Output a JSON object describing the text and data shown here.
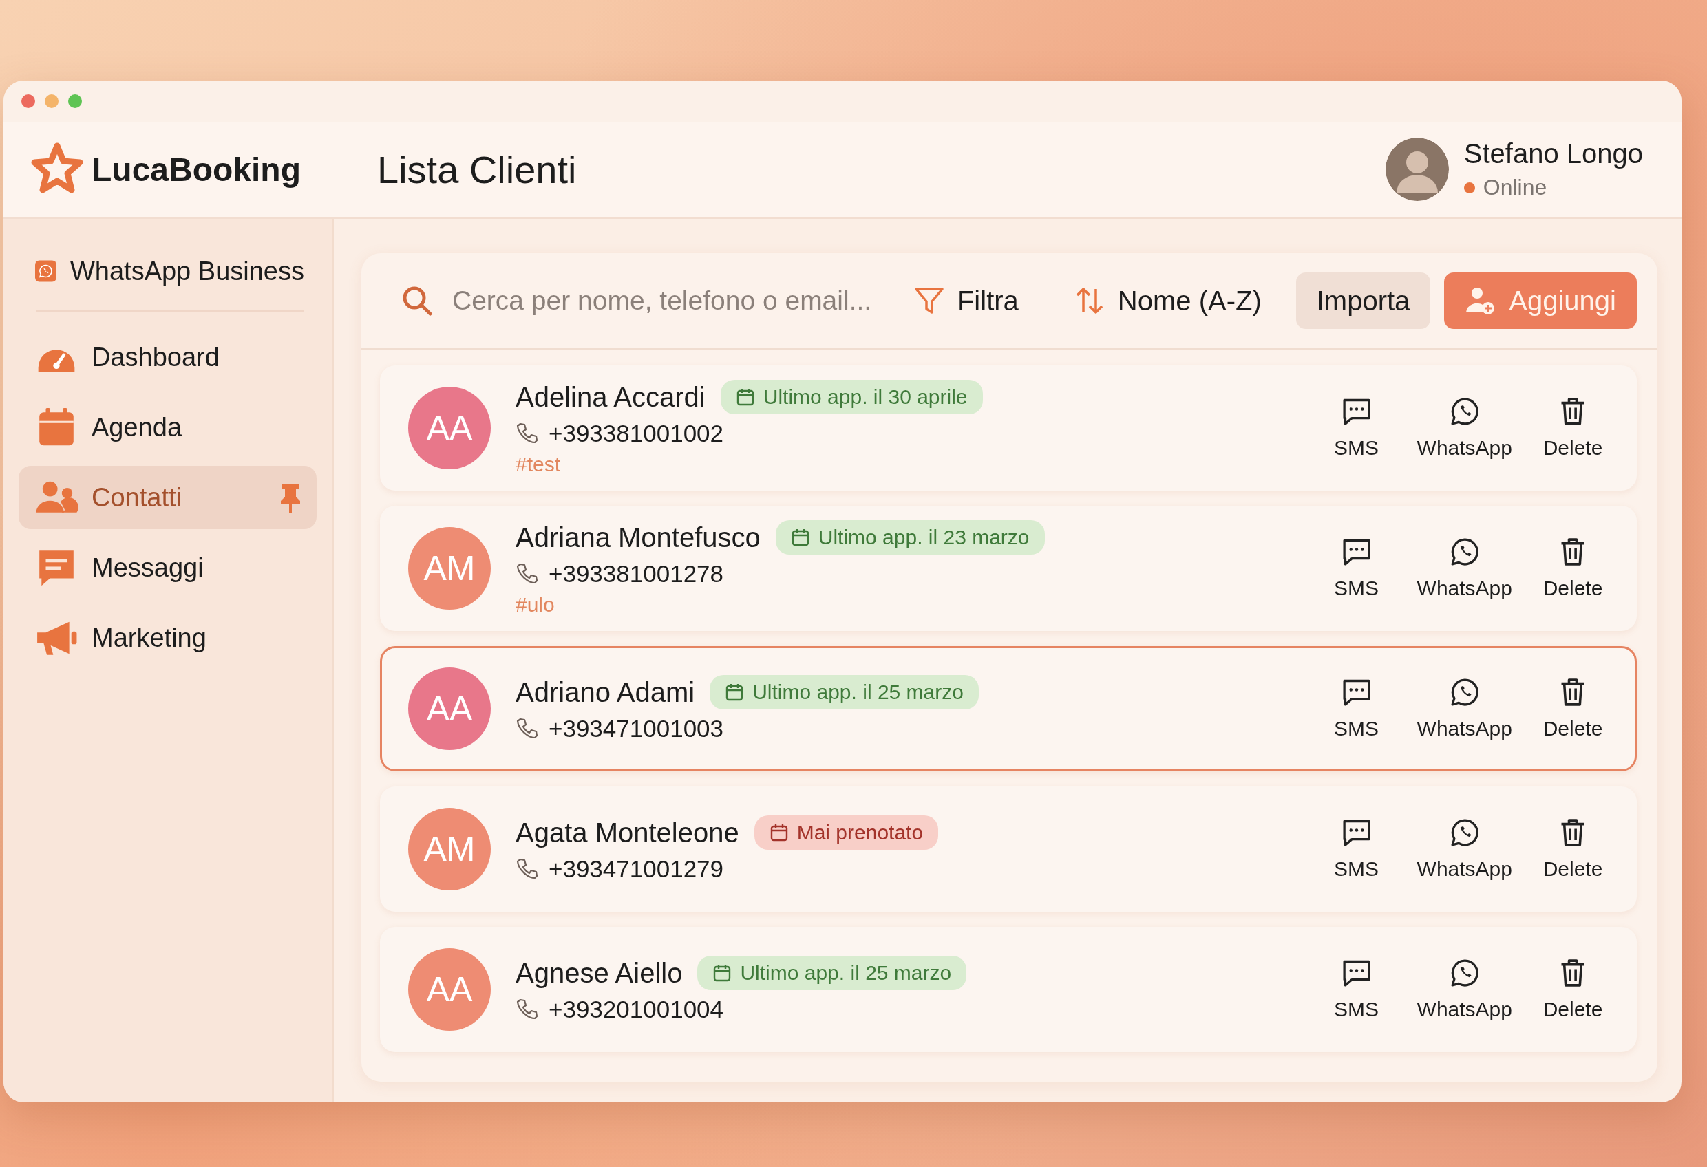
{
  "header": {
    "brand": "LucaBooking",
    "page_title": "Lista Clienti",
    "user": {
      "name": "Stefano Longo",
      "status": "Online"
    }
  },
  "sidebar": {
    "items": [
      {
        "label": "WhatsApp Business",
        "selected": false,
        "pinned": false
      },
      {
        "label": "Dashboard",
        "selected": false,
        "pinned": false
      },
      {
        "label": "Agenda",
        "selected": false,
        "pinned": false
      },
      {
        "label": "Contatti",
        "selected": true,
        "pinned": true
      },
      {
        "label": "Messaggi",
        "selected": false,
        "pinned": false
      },
      {
        "label": "Marketing",
        "selected": false,
        "pinned": false
      }
    ]
  },
  "toolbar": {
    "search": {
      "placeholder": "Cerca per nome, telefono o email..."
    },
    "filter": "Filtra",
    "sort": "Nome (A-Z)",
    "import": "Importa",
    "add": "Aggiungi"
  },
  "clients": [
    {
      "initials": "AA",
      "color": "#e8778a",
      "name": "Adelina Accardi",
      "badge": {
        "kind": "last",
        "text": "Ultimo app. il 30 aprile"
      },
      "phone": "+393381001002",
      "tag": "#test",
      "selected": false,
      "actions": [
        "SMS",
        "WhatsApp",
        "Delete"
      ]
    },
    {
      "initials": "AM",
      "color": "#ee8c73",
      "name": "Adriana Montefusco",
      "badge": {
        "kind": "last",
        "text": "Ultimo app. il 23 marzo"
      },
      "phone": "+393381001278",
      "tag": "#ulo",
      "selected": false,
      "actions": [
        "SMS",
        "WhatsApp",
        "Delete"
      ]
    },
    {
      "initials": "AA",
      "color": "#e8778a",
      "name": "Adriano Adami",
      "badge": {
        "kind": "last",
        "text": "Ultimo app. il 25 marzo"
      },
      "phone": "+393471001003",
      "selected": true,
      "actions": [
        "SMS",
        "WhatsApp",
        "Delete"
      ]
    },
    {
      "initials": "AM",
      "color": "#ee8c73",
      "name": "Agata Monteleone",
      "badge": {
        "kind": "never",
        "text": "Mai prenotato"
      },
      "phone": "+393471001279",
      "selected": false,
      "actions": [
        "SMS",
        "WhatsApp",
        "Delete"
      ]
    },
    {
      "initials": "AA",
      "color": "#ee8c73",
      "name": "Agnese Aiello",
      "badge": {
        "kind": "last",
        "text": "Ultimo app. il 25 marzo"
      },
      "phone": "+393201001004",
      "selected": false,
      "actions": [
        "SMS",
        "WhatsApp",
        "Delete"
      ]
    }
  ]
}
